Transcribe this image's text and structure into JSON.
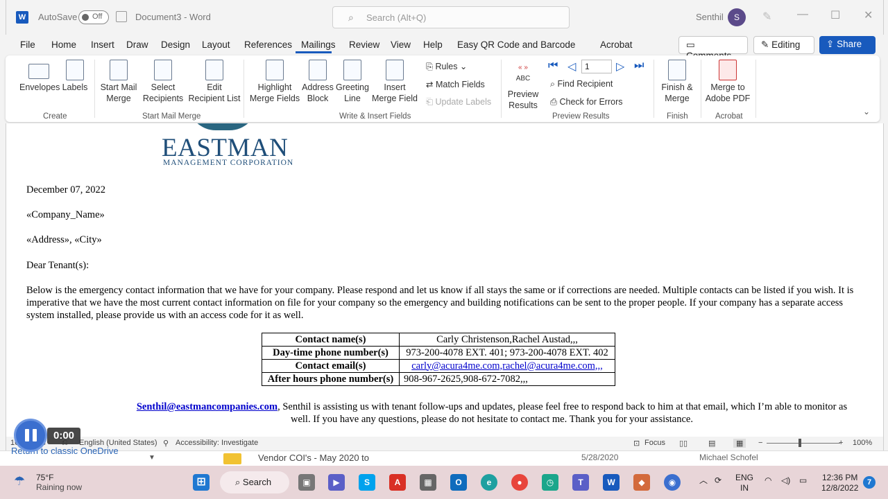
{
  "titlebar": {
    "app_logo": "W",
    "autosave_label": "AutoSave",
    "autosave_state": "Off",
    "document_title": "Document3  -  Word",
    "search_placeholder": "Search (Alt+Q)",
    "user_name": "Senthil",
    "user_initial": "S"
  },
  "menu": {
    "tabs": [
      "File",
      "Home",
      "Insert",
      "Draw",
      "Design",
      "Layout",
      "References",
      "Mailings",
      "Review",
      "View",
      "Help",
      "Easy QR Code and Barcode",
      "Acrobat"
    ],
    "active_tab": "Mailings",
    "comments": "Comments",
    "editing": "Editing",
    "share": "Share"
  },
  "ribbon": {
    "create": {
      "envelopes": "Envelopes",
      "labels": "Labels",
      "group": "Create"
    },
    "start": {
      "start_mail_merge": "Start Mail Merge",
      "select_recipients": "Select Recipients",
      "edit_recipient_list": "Edit Recipient List",
      "group": "Start Mail Merge"
    },
    "write": {
      "highlight": "Highlight Merge Fields",
      "address_block": "Address Block",
      "greeting_line": "Greeting Line",
      "insert_merge_field": "Insert Merge Field",
      "rules": "Rules",
      "match_fields": "Match Fields",
      "update_labels": "Update Labels",
      "group": "Write & Insert Fields"
    },
    "preview": {
      "preview_results": "Preview Results",
      "record": "1",
      "find_recipient": "Find Recipient",
      "check_errors": "Check for Errors",
      "group": "Preview Results",
      "abc": "ABC",
      "chevrons": "« »"
    },
    "finish": {
      "finish_merge": "Finish & Merge",
      "group": "Finish"
    },
    "acrobat": {
      "merge_pdf": "Merge to Adobe PDF",
      "group": "Acrobat"
    }
  },
  "document": {
    "logo_main": "EASTMAN",
    "logo_sub": "MANAGEMENT CORPORATION",
    "date": "December 07, 2022",
    "company": "«Company_Name»",
    "address": "«Address», «City»",
    "greeting": "Dear Tenant(s):",
    "paragraph": "Below is the emergency contact information that we have for your company.  Please respond and let us know if all stays the same or if corrections are needed. Multiple contacts can be listed if you wish. It is imperative that we have the most current contact information on file for your company so the emergency and building notifications can be sent to the proper people. If your company has a separate access system installed, please provide us with an access code for it as well.",
    "table": [
      {
        "label": "Contact name(s)",
        "value": "Carly Christenson,Rachel Austad,,,"
      },
      {
        "label": "Day-time phone number(s)",
        "value": "973-200-4078 EXT. 401; 973-200-4078 EXT. 402"
      },
      {
        "label": "Contact email(s)",
        "value": "carly@acura4me.com,rachel@acura4me.com,,,"
      },
      {
        "label": "After hours phone number(s)",
        "value": "908-967-2625,908-672-7082,,,"
      }
    ],
    "footer_email": "Senthil@eastmancompanies.com",
    "footer_text": ", Senthil is assisting us with tenant follow-ups and updates, please feel free to respond back to him at that email, which I’m able to monitor as well. If you have any questions, please do not hesitate to contact me. Thank you for your assistance."
  },
  "statusbar": {
    "words": "161 words",
    "language": "English (United States)",
    "accessibility": "Accessibility: Investigate",
    "focus": "Focus",
    "zoom": "100%"
  },
  "background": {
    "onedrive_link": "Return to classic OneDrive",
    "file_name": "Vendor COI's - May 2020 to",
    "file_date": "5/28/2020",
    "file_owner": "Michael Schofel"
  },
  "video": {
    "time": "0:00"
  },
  "taskbar": {
    "temp": "75°F",
    "weather": "Raining now",
    "search": "Search",
    "lang1": "ENG",
    "lang2": "IN",
    "time": "12:36 PM",
    "date": "12/8/2022",
    "notifications": "7"
  }
}
